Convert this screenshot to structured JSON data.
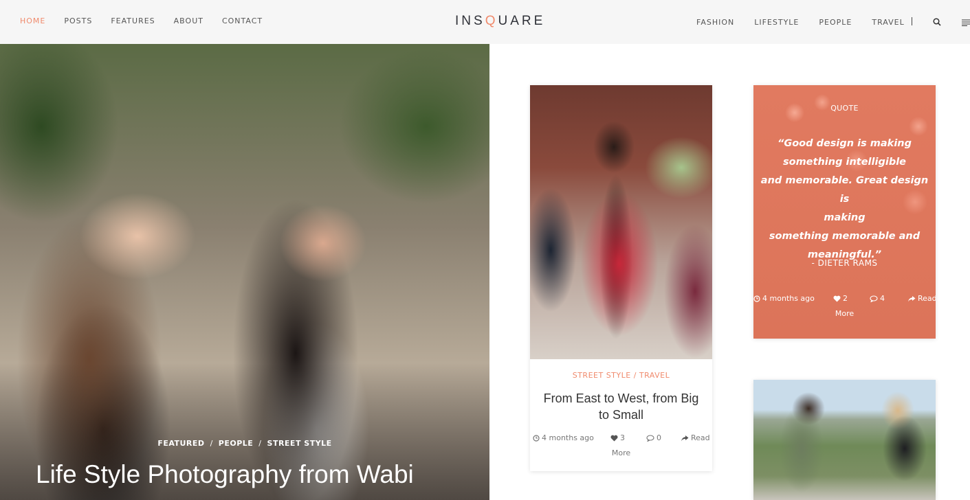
{
  "header": {
    "nav_left": [
      {
        "label": "HOME",
        "active": true
      },
      {
        "label": "POSTS",
        "active": false
      },
      {
        "label": "FEATURES",
        "active": false
      },
      {
        "label": "ABOUT",
        "active": false
      },
      {
        "label": "CONTACT",
        "active": false
      }
    ],
    "logo": {
      "prefix": "INS",
      "accent": "Q",
      "suffix": "UARE"
    },
    "nav_right": [
      {
        "label": "FASHION"
      },
      {
        "label": "LIFESTYLE"
      },
      {
        "label": "PEOPLE"
      },
      {
        "label": "TRAVEL"
      }
    ],
    "icons": {
      "search": "search-icon",
      "menu": "menu-icon"
    }
  },
  "hero": {
    "categories": [
      "FEATURED",
      "PEOPLE",
      "STREET STYLE"
    ],
    "separator": "/",
    "title": "Life Style Photography from Wabi",
    "image": "two-women-portrait-photo"
  },
  "posts": [
    {
      "type": "standard",
      "image": "man-in-plaid-shirt-photo",
      "categories": "STREET STYLE / TRAVEL",
      "title": "From East to West, from Big to Small",
      "meta": {
        "time": "4 months ago",
        "likes": "3",
        "comments": "0",
        "read": "Read",
        "more": "More"
      }
    },
    {
      "type": "quote",
      "label": "QUOTE",
      "quote_lines": [
        "“Good design is making",
        "something intelligible",
        "and memorable. Great design is",
        "making",
        "something memorable and",
        "meaningful.”"
      ],
      "author": "- DIETER RAMS",
      "meta": {
        "time": "4 months ago",
        "likes": "2",
        "comments": "4",
        "read": "Read",
        "more": "More"
      }
    },
    {
      "type": "image",
      "image": "couple-overlooking-city-photo"
    }
  ],
  "colors": {
    "accent": "#f08a6c",
    "quote_bg": "#df775c",
    "text_dark": "#333333"
  }
}
